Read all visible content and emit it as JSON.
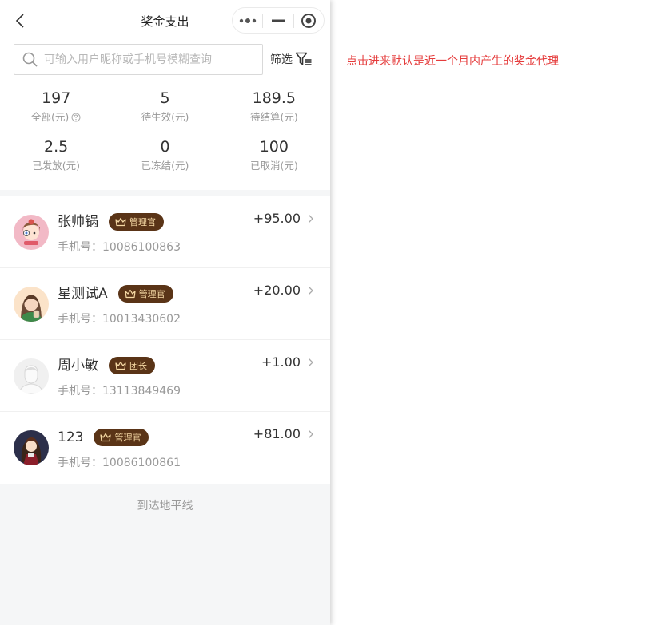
{
  "nav": {
    "title": "奖金支出"
  },
  "search": {
    "placeholder": "可输入用户昵称或手机号模糊查询",
    "filter_label": "筛选"
  },
  "stats": [
    {
      "value": "197",
      "label": "全部(元)"
    },
    {
      "value": "5",
      "label": "待生效(元)"
    },
    {
      "value": "189.5",
      "label": "待结算(元)"
    },
    {
      "value": "2.5",
      "label": "已发放(元)"
    },
    {
      "value": "0",
      "label": "已冻结(元)"
    },
    {
      "value": "100",
      "label": "已取消(元)"
    }
  ],
  "list": [
    {
      "name": "张帅锅",
      "badge": "管理官",
      "phone_label": "手机号：",
      "phone": "10086100863",
      "amount": "+95.00"
    },
    {
      "name": "星测试A",
      "badge": "管理官",
      "phone_label": "手机号：",
      "phone": "10013430602",
      "amount": "+20.00"
    },
    {
      "name": "周小敏",
      "badge": "团长",
      "phone_label": "手机号：",
      "phone": "13113849469",
      "amount": "+1.00"
    },
    {
      "name": "123",
      "badge": "管理官",
      "phone_label": "手机号：",
      "phone": "10086100861",
      "amount": "+81.00"
    }
  ],
  "footer": {
    "text": "到达地平线"
  },
  "annotation": {
    "text": "点击进来默认是近一个月内产生的奖金代理"
  },
  "colors": {
    "badge_bg": "#5a3417",
    "badge_text": "#f5d9a4",
    "annotation": "#e53c3c"
  }
}
